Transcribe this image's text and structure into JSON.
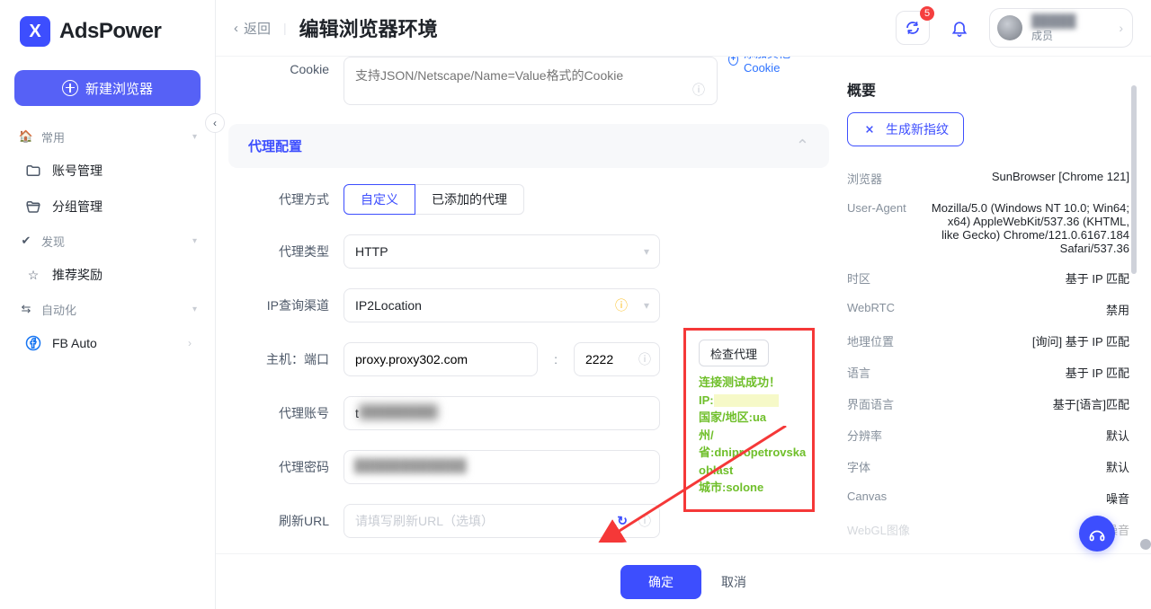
{
  "branding": {
    "name": "AdsPower",
    "mark": "X"
  },
  "sidebar": {
    "new_browser": "新建浏览器",
    "sections": [
      {
        "label": "常用"
      },
      {
        "label": "发现"
      },
      {
        "label": "自动化"
      }
    ],
    "items": {
      "account_mgmt": "账号管理",
      "group_mgmt": "分组管理",
      "recommend": "推荐奖励",
      "fb_auto": "FB Auto"
    }
  },
  "topbar": {
    "back": "返回",
    "title": "编辑浏览器环境",
    "badge": "5",
    "user_name": "█████",
    "member": "成员"
  },
  "form": {
    "cookie": {
      "label": "Cookie",
      "placeholder": "支持JSON/Netscape/Name=Value格式的Cookie"
    },
    "add_other_cookie": "添加其他Cookie",
    "section_proxy": "代理配置",
    "proxy_method": {
      "label": "代理方式",
      "custom": "自定义",
      "added": "已添加的代理"
    },
    "proxy_type": {
      "label": "代理类型",
      "value": "HTTP"
    },
    "ip_channel": {
      "label": "IP查询渠道",
      "value": "IP2Location"
    },
    "host_port": {
      "label": "主机：端口",
      "host": "proxy.proxy302.com",
      "port": "2222"
    },
    "proxy_user": {
      "label": "代理账号",
      "value": "t████████"
    },
    "proxy_pass": {
      "label": "代理密码",
      "value": "████████████"
    },
    "refresh_url": {
      "label": "刷新URL",
      "placeholder": "请填写刷新URL（选填）"
    },
    "check_proxy": {
      "button": "检查代理",
      "success": "连接测试成功！",
      "ip_label": "IP:",
      "country": "国家/地区:ua",
      "state": "州/省:dnipropetrovska oblast",
      "city": "城市:solone"
    }
  },
  "footer": {
    "ok": "确定",
    "cancel": "取消"
  },
  "summary": {
    "title": "概要",
    "gen_fp": "生成新指纹",
    "rows": {
      "browser": {
        "k": "浏览器",
        "v": "SunBrowser [Chrome 121]"
      },
      "ua": {
        "k": "User-Agent",
        "v": "Mozilla/5.0 (Windows NT 10.0; Win64; x64) AppleWebKit/537.36 (KHTML, like Gecko) Chrome/121.0.6167.184 Safari/537.36"
      },
      "tz": {
        "k": "时区",
        "v": "基于 IP 匹配"
      },
      "webrtc": {
        "k": "WebRTC",
        "v": "禁用"
      },
      "geo": {
        "k": "地理位置",
        "v": "[询问] 基于 IP 匹配"
      },
      "lang": {
        "k": "语言",
        "v": "基于 IP 匹配"
      },
      "ui_lang": {
        "k": "界面语言",
        "v": "基于[语言]匹配"
      },
      "res": {
        "k": "分辨率",
        "v": "默认"
      },
      "font": {
        "k": "字体",
        "v": "默认"
      },
      "canvas": {
        "k": "Canvas",
        "v": "噪音"
      },
      "webgl_img": {
        "k": "WebGL图像",
        "v": "噪音"
      }
    }
  }
}
